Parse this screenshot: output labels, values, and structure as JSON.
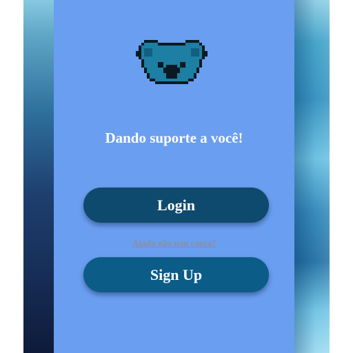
{
  "app": {
    "tagline": "Dando suporte a você!",
    "logo_icon": "koala-icon"
  },
  "actions": {
    "login_label": "Login",
    "no_account_label": "Ainda não tem conta?",
    "signup_label": "Sign Up"
  },
  "colors": {
    "panel_background": "#6a9ef0",
    "login_button": "#0e4a6d",
    "signup_button": "#0b5c87",
    "text": "#ffffff",
    "link_text": "#8a8ea0"
  }
}
